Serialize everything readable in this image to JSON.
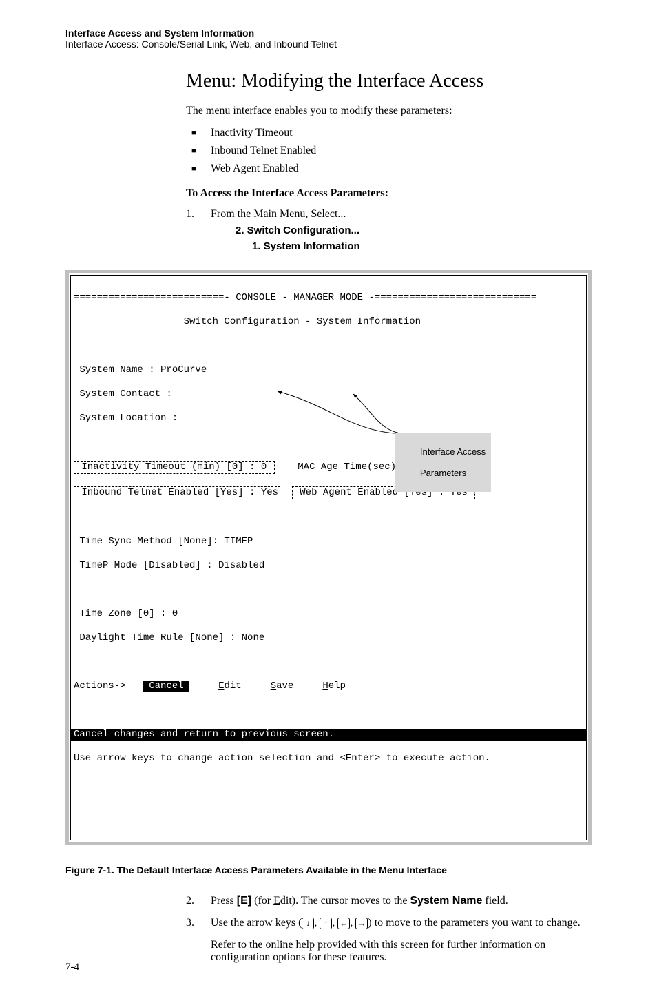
{
  "header": {
    "line1": "Interface Access and System Information",
    "line2": "Interface Access: Console/Serial Link, Web, and Inbound Telnet"
  },
  "section_title": "Menu: Modifying the Interface Access",
  "intro": "The menu interface enables you to modify these parameters:",
  "bullets": [
    "Inactivity Timeout",
    "Inbound Telnet Enabled",
    "Web Agent Enabled"
  ],
  "subhead": "To Access the Interface Access Parameters:",
  "step1": "From the Main Menu, Select...",
  "menu_path_1": "2. Switch Configuration...",
  "menu_path_2": "1. System Information",
  "console": {
    "title_rule": "==========================- CONSOLE - MANAGER MODE -============================",
    "subtitle_indent": "                   Switch Configuration - System Information",
    "sys_name": " System Name : ProCurve",
    "sys_contact": " System Contact :",
    "sys_loc": " System Location :",
    "row_left_1": " Inactivity Timeout (min) [0] : 0 ",
    "row_left_2": " Inbound Telnet Enabled [Yes] : Yes",
    "row_right_1": " MAC Age Time(sec) [300] : 300",
    "row_right_2": " Web Agent Enabled [Yes] : Yes ",
    "time_sync": " Time Sync Method [None]: TIMEP",
    "timep_mode": " TimeP Mode [Disabled] : Disabled",
    "tz": " Time Zone [0] : 0",
    "dst": " Daylight Time Rule [None] : None",
    "actions_prefix": "Actions->   ",
    "action_cancel": "Cancel",
    "action_edit_pre": "E",
    "action_edit_rest": "dit",
    "action_save_pre": "S",
    "action_save_rest": "ave",
    "action_help_pre": "H",
    "action_help_rest": "elp",
    "status_line": "Cancel changes and return to previous screen.",
    "hint_line": "Use arrow keys to change action selection and <Enter> to execute action."
  },
  "callout_label_l1": "Interface Access",
  "callout_label_l2": "Parameters",
  "figure_caption": "Figure 7-1.   The Default Interface Access Parameters Available in the Menu Interface",
  "step2_num": "2.",
  "step2_a": "Press ",
  "step2_key": "[E]",
  "step2_b": " (for ",
  "step2_c": "dit). The cursor moves to the ",
  "step2_field": "System Name",
  "step2_d": " field.",
  "step3_num": "3.",
  "step3_a": "Use the arrow keys (",
  "step3_b": ") to move to the parameters you want to change.",
  "step3_para2": "Refer to the online help provided with this screen for further information on configuration options for these features.",
  "page_num": "7-4"
}
